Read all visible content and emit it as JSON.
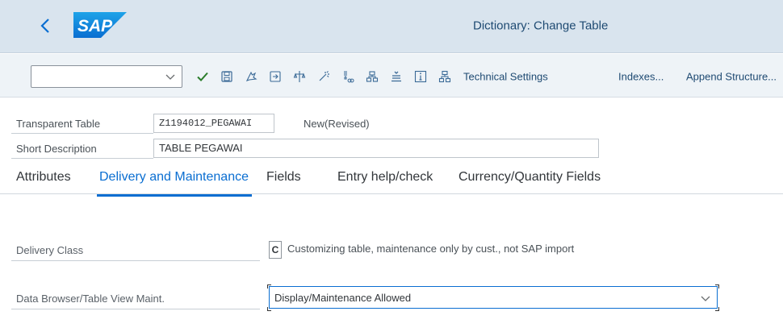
{
  "header": {
    "title": "Dictionary: Change Table",
    "logo_text": "SAP"
  },
  "toolbar": {
    "command_value": "",
    "icons": [
      "check-icon",
      "save-icon",
      "other-object-icon",
      "activate-icon",
      "where-used-icon",
      "display-object-list-icon",
      "hierarchy-icon",
      "structure-icon",
      "insert-row-icon",
      "info-icon",
      "network-icon"
    ],
    "technical_settings_label": "Technical Settings",
    "indexes_label": "Indexes...",
    "append_structure_label": "Append Structure..."
  },
  "form": {
    "table_type_label": "Transparent Table",
    "table_name": "Z1194012_PEGAWAI",
    "status": "New(Revised)",
    "short_desc_label": "Short Description",
    "short_desc_value": "TABLE PEGAWAI"
  },
  "tabs": [
    {
      "label": "Attributes"
    },
    {
      "label": "Delivery and Maintenance"
    },
    {
      "label": "Fields"
    },
    {
      "label": "Entry help/check"
    },
    {
      "label": "Currency/Quantity Fields"
    }
  ],
  "delivery": {
    "class_label": "Delivery Class",
    "class_code": "C",
    "class_desc": "Customizing table, maintenance only by cust., not SAP import",
    "browser_label": "Data Browser/Table View Maint.",
    "browser_value": "Display/Maintenance Allowed"
  },
  "colors": {
    "accent": "#0a6ed1",
    "titlebar": "#d9e4ee",
    "toolbar": "#eef3f7"
  }
}
